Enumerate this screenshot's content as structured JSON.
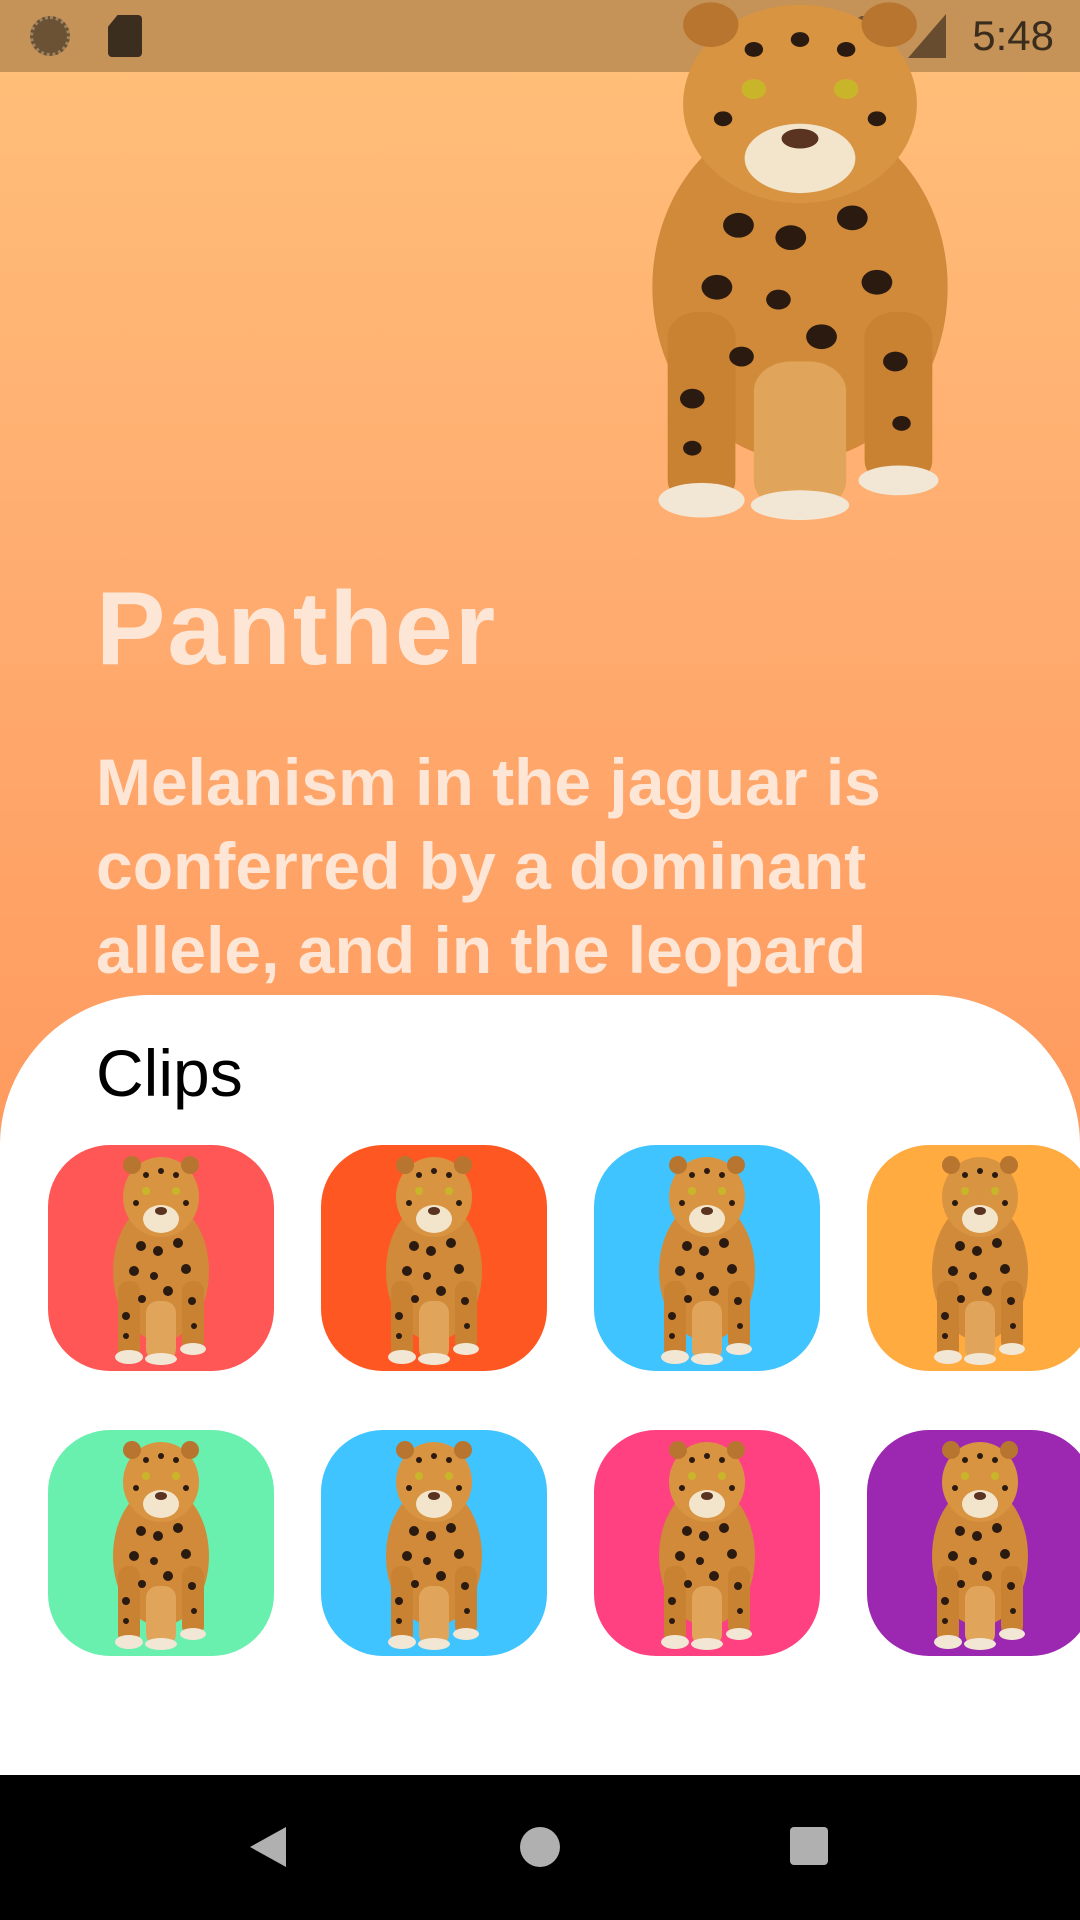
{
  "status_bar": {
    "time": "5:48",
    "icons": [
      "sync-icon",
      "sd-card-icon",
      "wifi-icon",
      "signal-icon"
    ]
  },
  "hero": {
    "image": "jaguar-icon",
    "title": "Panther",
    "description": "Melanism in the jaguar is conferred by a dominant allele, and in the leopard"
  },
  "clips": {
    "heading": "Clips",
    "tiles": [
      {
        "color": "#ff5656",
        "icon": "jaguar-icon"
      },
      {
        "color": "#ff5722",
        "icon": "jaguar-icon"
      },
      {
        "color": "#40c4ff",
        "icon": "jaguar-icon"
      },
      {
        "color": "#ffab40",
        "icon": "jaguar-icon"
      },
      {
        "color": "#69f0ae",
        "icon": "jaguar-icon"
      },
      {
        "color": "#40c4ff",
        "icon": "jaguar-icon"
      },
      {
        "color": "#ff4081",
        "icon": "jaguar-icon"
      },
      {
        "color": "#9c27b0",
        "icon": "jaguar-icon"
      }
    ]
  },
  "nav_bar": {
    "buttons": [
      "back-icon",
      "home-icon",
      "recents-icon"
    ]
  }
}
